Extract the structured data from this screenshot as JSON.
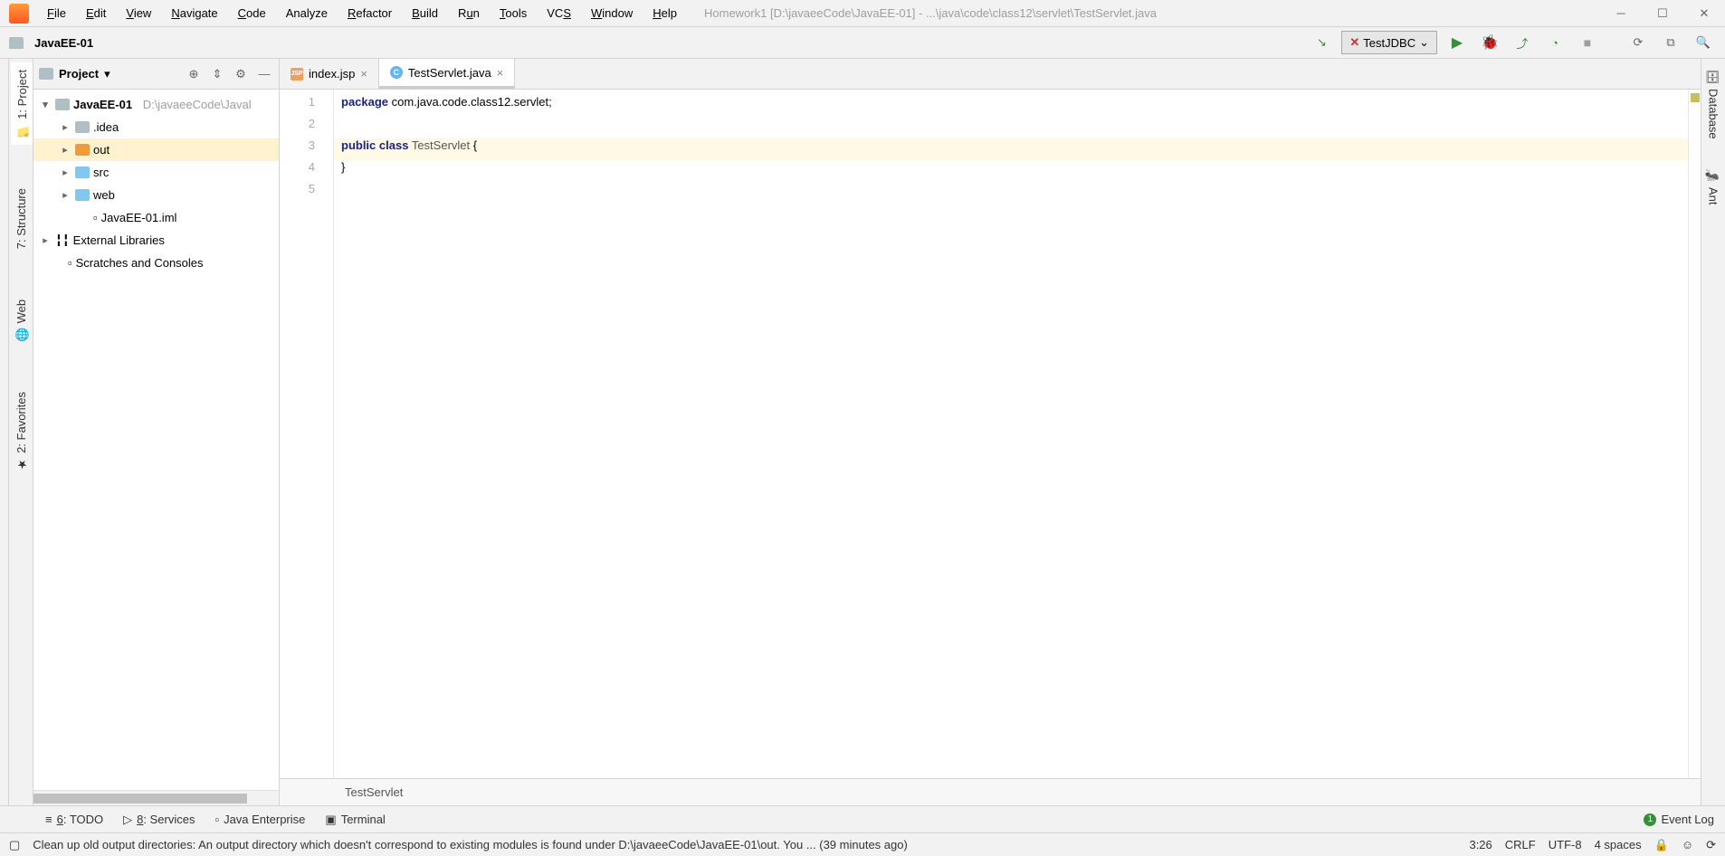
{
  "menu": {
    "file": "File",
    "edit": "Edit",
    "view": "View",
    "navigate": "Navigate",
    "code": "Code",
    "analyze": "Analyze",
    "refactor": "Refactor",
    "build": "Build",
    "run": "Run",
    "tools": "Tools",
    "vcs": "VCS",
    "window": "Window",
    "help": "Help"
  },
  "title_path": "Homework1 [D:\\javaeeCode\\JavaEE-01] - ...\\java\\code\\class12\\servlet\\TestServlet.java",
  "nav_project": "JavaEE-01",
  "run_config": "TestJDBC",
  "left_tabs": {
    "project": "1: Project",
    "structure": "7: Structure",
    "web": "Web",
    "favorites": "2: Favorites"
  },
  "pp": {
    "label": "Project"
  },
  "tree": {
    "root": "JavaEE-01",
    "root_path": "D:\\javaeeCode\\Javal",
    "idea": ".idea",
    "out": "out",
    "src": "src",
    "web": "web",
    "iml": "JavaEE-01.iml",
    "ext": "External Libraries",
    "scratch": "Scratches and Consoles"
  },
  "tabs": {
    "t1": "index.jsp",
    "t2": "TestServlet.java"
  },
  "gutter": [
    "1",
    "2",
    "3",
    "4",
    "5"
  ],
  "code": {
    "l1_kw": "package",
    "l1_rest": " com.java.code.class12.servlet;",
    "l3_pub": "public",
    "l3_cls": "class",
    "l3_name": " TestServlet ",
    "l3_br": "{",
    "l4": "}"
  },
  "breadcrumb": "TestServlet",
  "right_tabs": {
    "db": "Database",
    "ant": "Ant"
  },
  "bottom": {
    "todo": "6: TODO",
    "services": "8: Services",
    "je": "Java Enterprise",
    "term": "Terminal",
    "evlog": "Event Log"
  },
  "status": {
    "msg": "Clean up old output directories: An output directory which doesn't correspond to existing modules is found under D:\\javaeeCode\\JavaEE-01\\out. You ... (39 minutes ago)",
    "pos": "3:26",
    "le": "CRLF",
    "enc": "UTF-8",
    "indent": "4 spaces"
  }
}
